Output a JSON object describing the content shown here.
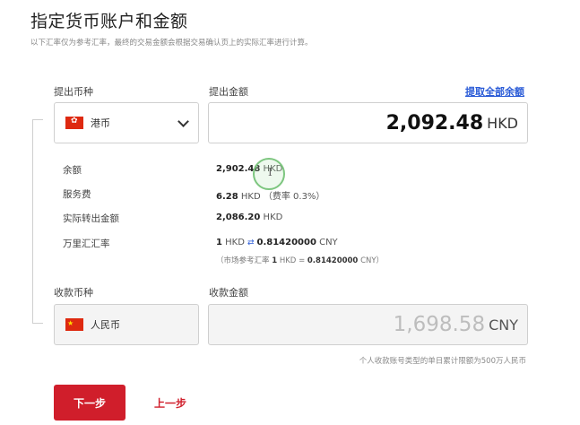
{
  "header": {
    "title": "指定货币账户和金额",
    "subtitle": "以下汇率仅为参考汇率，最终的交易金额会根据交易确认页上的实际汇率进行计算。"
  },
  "withdraw": {
    "currency_label": "提出币种",
    "amount_label": "提出金额",
    "withdraw_all_link": "提取全部余额",
    "currency_selected": "港币",
    "amount_value": "2,092.48",
    "amount_currency": "HKD"
  },
  "details": [
    {
      "label": "余额",
      "value": "2,902.48",
      "unit": "HKD",
      "extra": ""
    },
    {
      "label": "服务费",
      "value": "6.28",
      "unit": "HKD",
      "extra": "（费率 0.3%）"
    },
    {
      "label": "实际转出金额",
      "value": "2,086.20",
      "unit": "HKD",
      "extra": ""
    }
  ],
  "rate": {
    "label": "万里汇汇率",
    "left_amount": "1",
    "left_unit": "HKD",
    "arrow": "⇄",
    "right_amount": "0.81420000",
    "right_unit": "CNY",
    "market_prefix": "（市场参考汇率",
    "market_left_amount": "1",
    "market_left_unit": "HKD",
    "market_eq": "=",
    "market_right_amount": "0.81420000",
    "market_right_unit": "CNY）"
  },
  "receive": {
    "currency_label": "收款币种",
    "amount_label": "收款金额",
    "currency_selected": "人民币",
    "amount_value": "1,698.58",
    "amount_currency": "CNY",
    "limit_note": "个人收款账号类型的单日累计限额为500万人民币"
  },
  "actions": {
    "next_label": "下一步",
    "prev_label": "上一步"
  },
  "colors": {
    "accent_red": "#d01e2b",
    "link_blue": "#2a5bd7",
    "cursor_green": "#7dc67f"
  },
  "icons": {
    "hk_flag": "hong-kong-flag-icon",
    "cn_flag": "china-flag-icon",
    "dropdown": "chevron-down-icon",
    "swap": "swap-arrows-icon"
  }
}
